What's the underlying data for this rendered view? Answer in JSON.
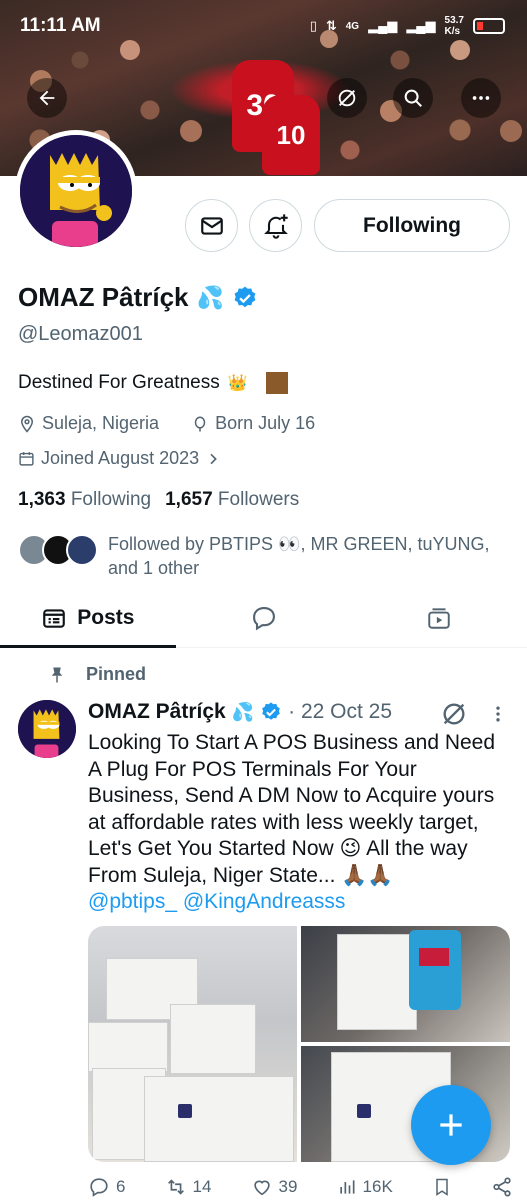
{
  "status_bar": {
    "time": "11:11 AM",
    "network": "4G",
    "speed": "53.7",
    "speed_unit": "K/s"
  },
  "banner": {
    "player_left_number": "30",
    "player_right_number": "10"
  },
  "profile": {
    "name": "OMAZ Pâtríçk",
    "name_emoji": "💦",
    "handle": "@Leomaz001",
    "bio": "Destined For Greatness",
    "bio_emoji": "👑",
    "location": "Suleja, Nigeria",
    "birthday": "Born July 16",
    "joined": "Joined August 2023",
    "following_count": "1,363",
    "following_label": "Following",
    "followers_count": "1,657",
    "followers_label": "Followers",
    "followed_by": "Followed by PBTIPS 👀, MR GREEN, tuYUNG, and 1 other"
  },
  "actions": {
    "following_button": "Following"
  },
  "tabs": [
    {
      "label": "Posts"
    }
  ],
  "post": {
    "pinned_label": "Pinned",
    "author": "OMAZ Pâtríçk",
    "author_emoji": "💦",
    "date": "· 22 Oct 25",
    "text": "Looking To Start A POS Business and Need A Plug For POS Terminals For Your Business, Send A DM Now to Acquire yours at affordable rates with less weekly target, Let's Get You Started Now 😉 All the way From Suleja, Niger State... 🙏🏾🙏🏾",
    "mentions": "@pbtips_ @KingAndreasss",
    "replies": "6",
    "reposts": "14",
    "likes": "39",
    "views": "16K"
  },
  "colors": {
    "accent": "#1d9bf0",
    "text": "#0f1419",
    "secondary": "#536471",
    "border": "#cfd9de"
  }
}
